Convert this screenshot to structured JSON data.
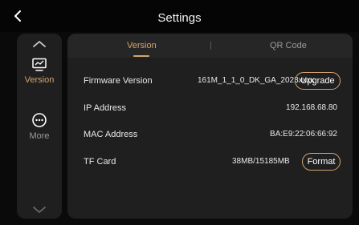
{
  "header": {
    "title": "Settings"
  },
  "sidebar": {
    "items": [
      {
        "label": "Version",
        "icon": "monitor-icon",
        "active": true
      },
      {
        "label": "More",
        "icon": "more-icon",
        "active": false
      }
    ]
  },
  "tabs": [
    {
      "label": "Version",
      "active": true
    },
    {
      "label": "QR Code",
      "active": false
    }
  ],
  "rows": {
    "firmware": {
      "label": "Firmware Version",
      "value": "161M_1_1_0_DK_GA_2023xxxx",
      "button": "Upgrade"
    },
    "ip": {
      "label": "IP Address",
      "value": "192.168.68.80"
    },
    "mac": {
      "label": "MAC Address",
      "value": "BA:E9:22:06:66:92"
    },
    "tf": {
      "label": "TF Card",
      "value": "38MB/15185MB",
      "button": "Format"
    }
  },
  "colors": {
    "accent": "#d4a571",
    "panel": "#1f1f1f",
    "background": "#0a0a0a"
  }
}
